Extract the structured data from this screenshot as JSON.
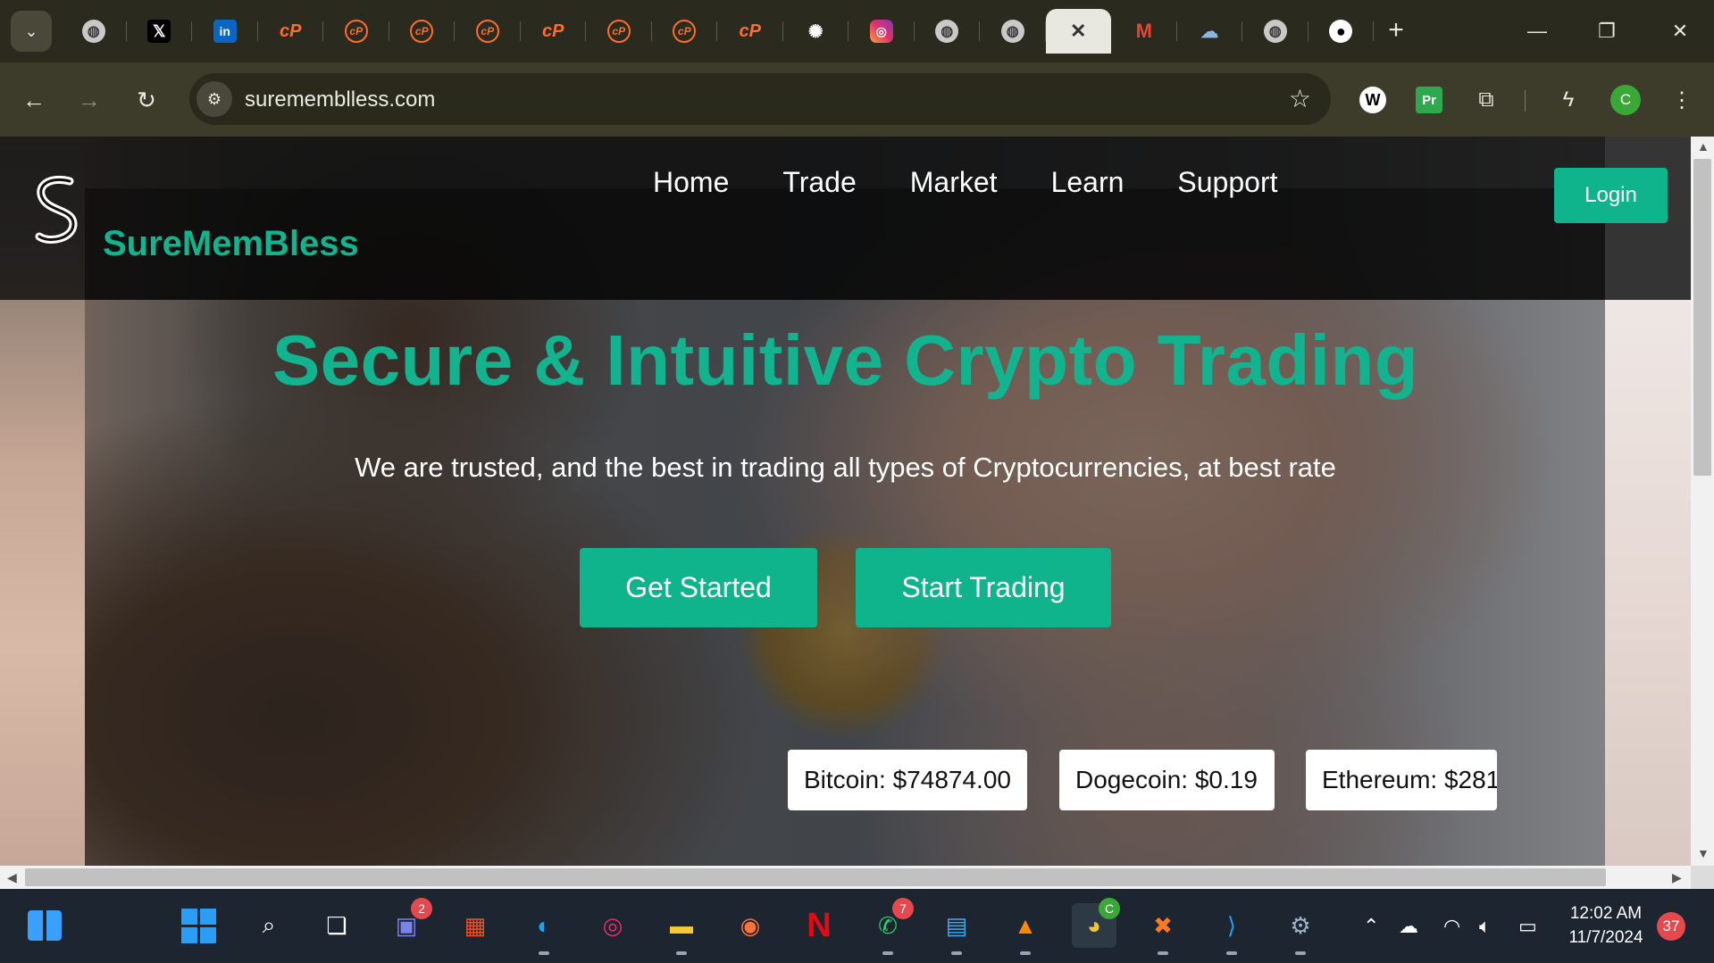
{
  "browser": {
    "tabs": [
      {
        "icon": "globe-icon",
        "glyph": "◍"
      },
      {
        "icon": "x-logo-icon",
        "glyph": "𝕏"
      },
      {
        "icon": "linkedin-icon",
        "glyph": "in"
      },
      {
        "icon": "cpanel-icon",
        "glyph": "cP"
      },
      {
        "icon": "cpanel-circle-icon",
        "glyph": "cP"
      },
      {
        "icon": "cpanel-circle-icon",
        "glyph": "cP"
      },
      {
        "icon": "cpanel-circle-icon",
        "glyph": "cP"
      },
      {
        "icon": "cpanel-icon",
        "glyph": "cP"
      },
      {
        "icon": "cpanel-circle-icon",
        "glyph": "cP"
      },
      {
        "icon": "cpanel-circle-icon",
        "glyph": "cP"
      },
      {
        "icon": "cpanel-icon",
        "glyph": "cP"
      },
      {
        "icon": "chatgpt-icon",
        "glyph": "✺"
      },
      {
        "icon": "instagram-icon",
        "glyph": "◎"
      },
      {
        "icon": "globe-icon",
        "glyph": "◍"
      },
      {
        "icon": "globe-icon",
        "glyph": "◍"
      },
      {
        "icon": "close-icon",
        "glyph": "✕",
        "active": true
      },
      {
        "icon": "gmail-icon",
        "glyph": "M"
      },
      {
        "icon": "cloud-icon",
        "glyph": "☁"
      },
      {
        "icon": "globe-icon",
        "glyph": "◍"
      },
      {
        "icon": "github-icon",
        "glyph": "●"
      }
    ],
    "address": {
      "url": "surememblless.com"
    },
    "profile_initial": "C",
    "extensions": {
      "w_label": "W",
      "pr_label": "Pr"
    }
  },
  "page": {
    "brand": "SureMemBless",
    "nav": [
      "Home",
      "Trade",
      "Market",
      "Learn",
      "Support"
    ],
    "login_label": "Login",
    "hero_title": "Secure & Intuitive Crypto Trading",
    "hero_subtitle": "We are trusted, and the best in trading all types of Cryptocurrencies, at best rate",
    "cta_primary": "Get Started",
    "cta_secondary": "Start Trading",
    "prices": [
      "Bitcoin: $74874.00",
      "Dogecoin: $0.19",
      "Ethereum: $281"
    ],
    "colors": {
      "accent": "#12b38e"
    }
  },
  "taskbar": {
    "teams_badge": "2",
    "whatsapp_badge": "7",
    "chrome_profile_badge": "C",
    "time": "12:02 AM",
    "date": "11/7/2024",
    "notifications": "37"
  }
}
